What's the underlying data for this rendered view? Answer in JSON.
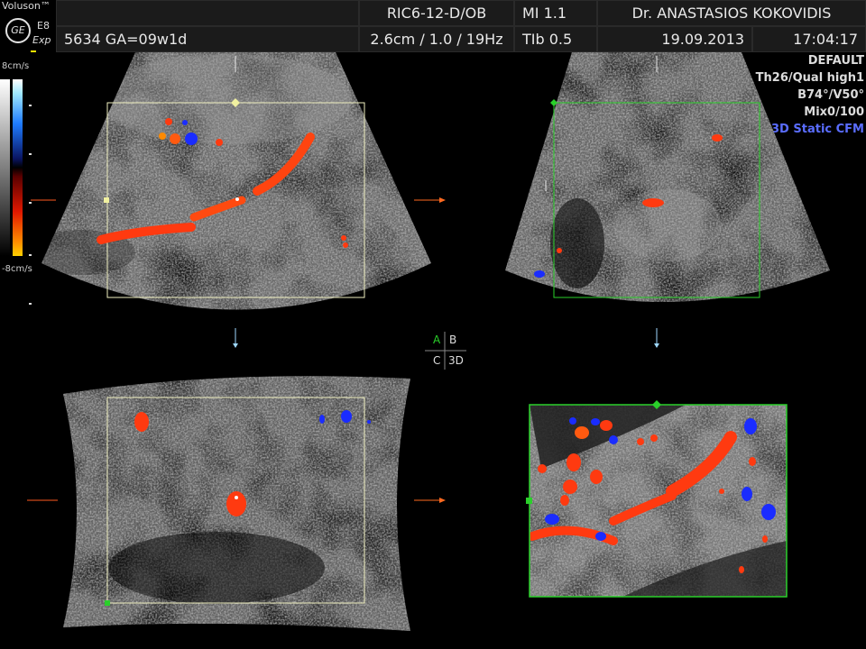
{
  "header": {
    "brand": "Voluson™",
    "model": "E8",
    "edition": "Exp",
    "ge_logo": "GE",
    "probe": "RIC6-12-D/OB",
    "mi": "MI  1.1",
    "operator": "Dr. ANASTASIOS KOKOVIDIS",
    "patient": "5634  GA=09w1d",
    "settings": "2.6cm / 1.0 / 19Hz",
    "tib": "TIb  0.5",
    "date": "19.09.2013",
    "time": "17:04:17"
  },
  "info_panel": {
    "preset": "DEFAULT",
    "quality": "Th26/Qual high1",
    "angle": "B74°/V50°",
    "mix": "Mix0/100",
    "mode": "3D Static CFM"
  },
  "color_scale": {
    "top": "8cm/s",
    "bottom": "-8cm/s"
  },
  "orientation": {
    "a": "A",
    "b": "B",
    "c": "C",
    "d": "3D"
  },
  "colors": {
    "flow_red": "#ff3a10",
    "flow_orange": "#ff8a00",
    "flow_blue": "#1a2cff",
    "roi_yellow": "#f0f0c0",
    "roi_green": "#2ad02a"
  }
}
